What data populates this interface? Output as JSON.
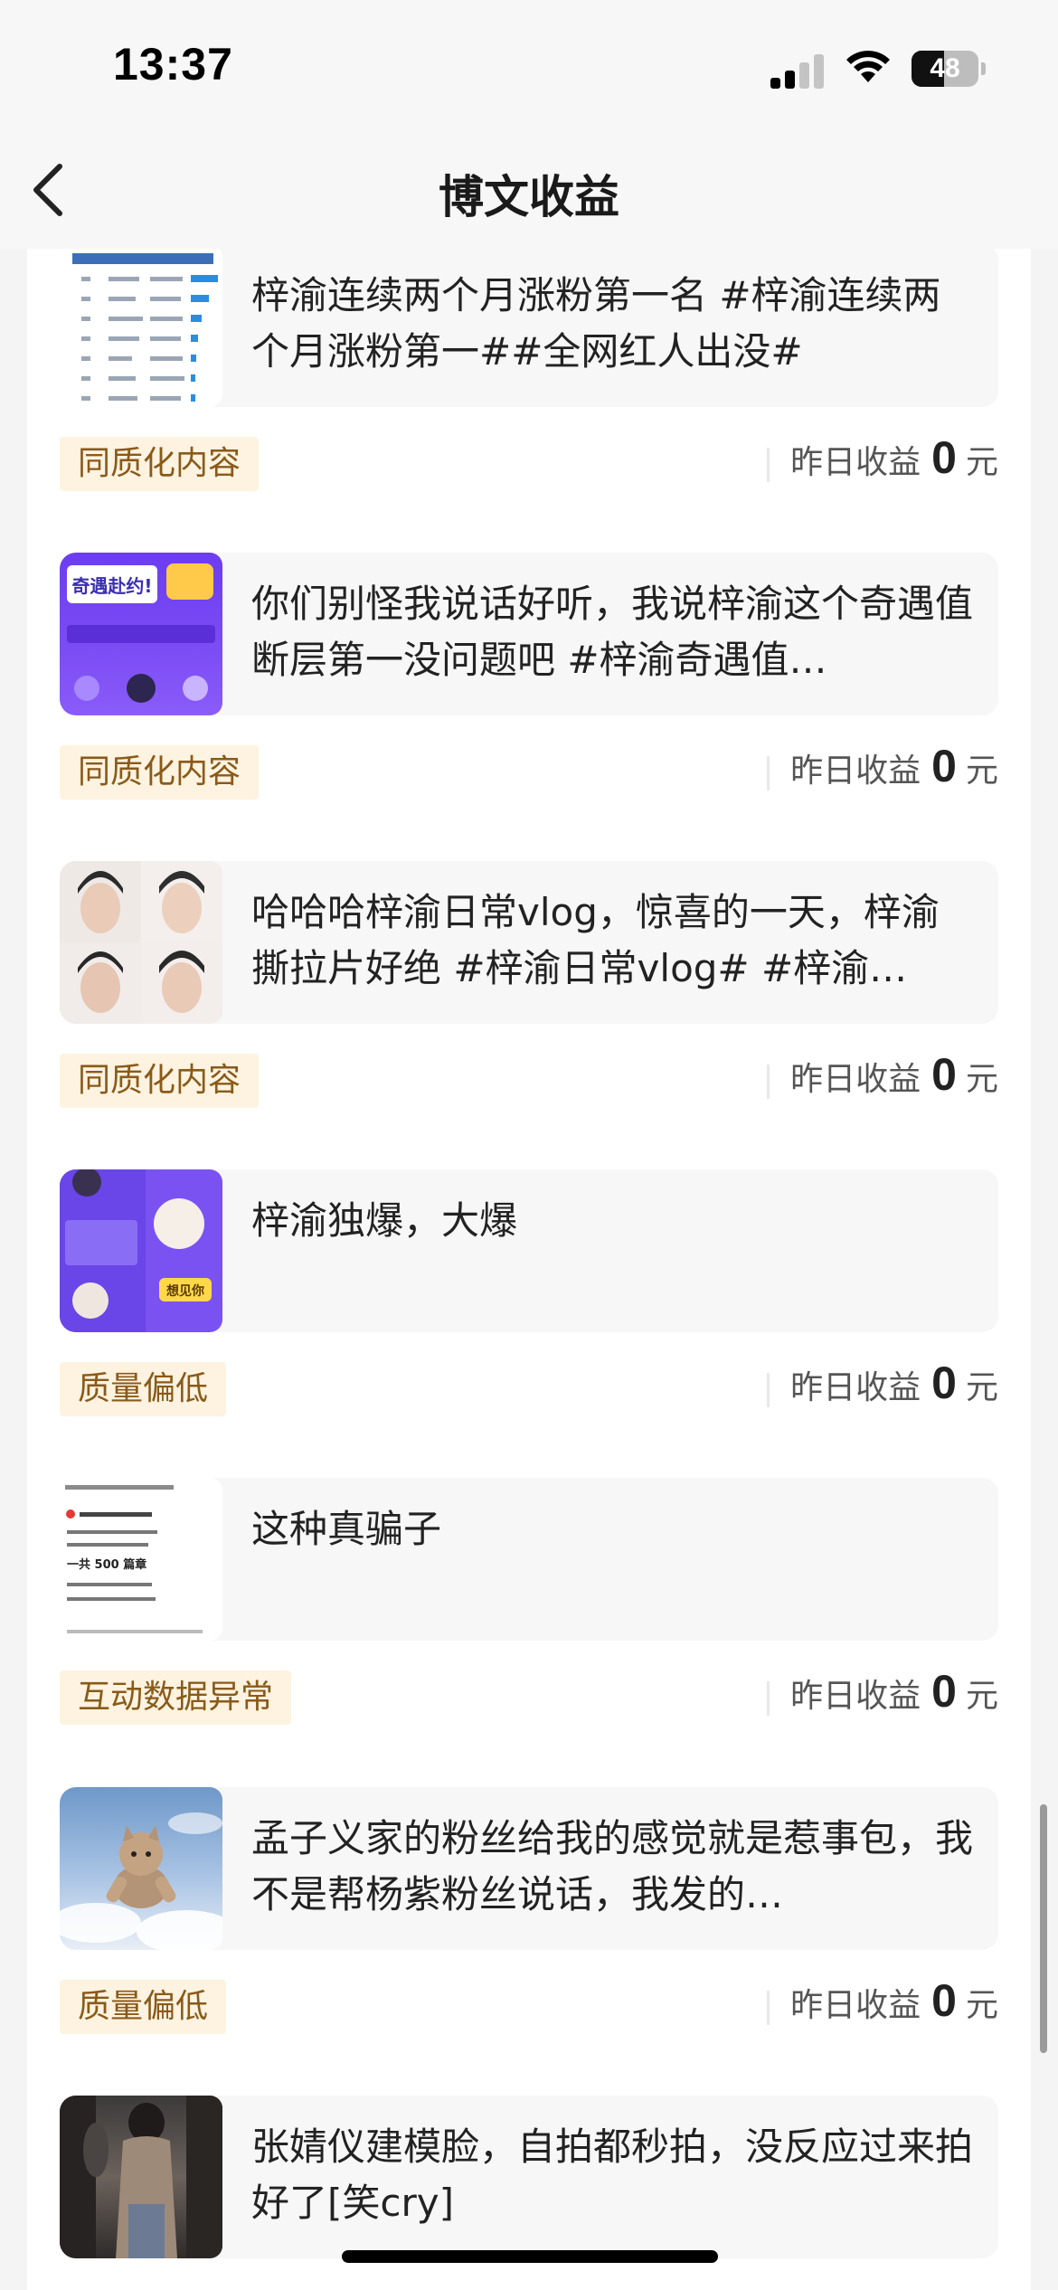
{
  "status_bar": {
    "time": "13:37",
    "battery": "48",
    "battery_level": 0.48,
    "icons": [
      "cellular-signal-icon",
      "wifi-icon",
      "battery-icon"
    ]
  },
  "header": {
    "title": "博文收益",
    "back_icon": "chevron-left-icon"
  },
  "items": [
    {
      "text": "梓渝连续两个月涨粉第一名 #梓渝连续两个月涨粉第一##全网红人出没#",
      "tag": "同质化内容",
      "earn_label": "昨日收益",
      "earn_value": "0",
      "earn_unit": "元",
      "thumb_icon": "ranking-table-thumbnail"
    },
    {
      "text": "你们别怪我说话好听，我说梓渝这个奇遇值断层第一没问题吧 #梓渝奇遇值…",
      "tag": "同质化内容",
      "earn_label": "昨日收益",
      "earn_value": "0",
      "earn_unit": "元",
      "thumb_icon": "purple-event-thumbnail",
      "thumb_text": "奇遇赴约!"
    },
    {
      "text": "哈哈哈梓渝日常vlog，惊喜的一天，梓渝撕拉片好绝 #梓渝日常vlog# #梓渝…",
      "tag": "同质化内容",
      "earn_label": "昨日收益",
      "earn_value": "0",
      "earn_unit": "元",
      "thumb_icon": "portrait-grid-thumbnail"
    },
    {
      "text": "梓渝独爆，大爆",
      "tag": "质量偏低",
      "earn_label": "昨日收益",
      "earn_value": "0",
      "earn_unit": "元",
      "thumb_icon": "purple-card-thumbnail",
      "thumb_text": "想见你"
    },
    {
      "text": "这种真骗子",
      "tag": "互动数据异常",
      "earn_label": "昨日收益",
      "earn_value": "0",
      "earn_unit": "元",
      "thumb_icon": "text-screenshot-thumbnail",
      "thumb_text": "一共 500 篇章"
    },
    {
      "text": "孟子义家的粉丝给我的感觉就是惹事包，我不是帮杨紫粉丝说话，我发的…",
      "tag": "质量偏低",
      "earn_label": "昨日收益",
      "earn_value": "0",
      "earn_unit": "元",
      "thumb_icon": "flying-cat-thumbnail"
    },
    {
      "text": "张婧仪建模脸，自拍都秒拍，没反应过来拍好了[笑cry]",
      "thumb_icon": "street-photo-thumbnail"
    }
  ]
}
